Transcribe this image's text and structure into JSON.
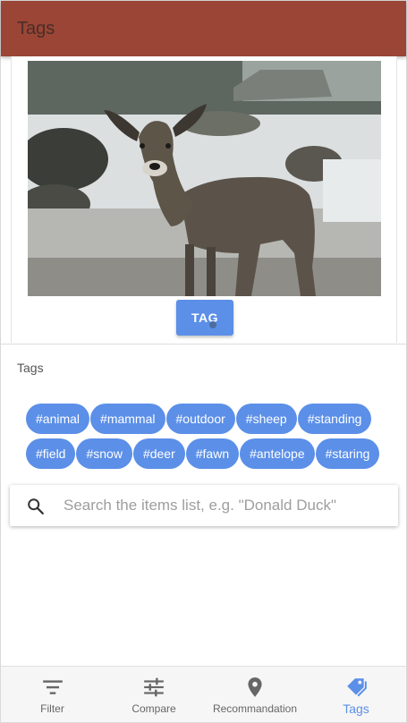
{
  "appbar": {
    "title": "Tags"
  },
  "photo": {
    "tag_button_label": "TAG"
  },
  "tags_section": {
    "heading": "Tags",
    "row1": [
      "#animal",
      "#mammal",
      "#outdoor",
      "#sheep",
      "#standing"
    ],
    "row2": [
      "#field",
      "#snow",
      "#deer",
      "#fawn",
      "#antelope",
      "#staring"
    ]
  },
  "search": {
    "placeholder": "Search the items list, e.g. \"Donald Duck\"",
    "value": ""
  },
  "bottom_nav": {
    "items": [
      {
        "label": "Filter",
        "icon": "filter-icon"
      },
      {
        "label": "Compare",
        "icon": "sliders-icon"
      },
      {
        "label": "Recommandation",
        "icon": "location-pin-icon"
      },
      {
        "label": "Tags",
        "icon": "tag-icon",
        "active": true
      }
    ]
  },
  "colors": {
    "appbar": "#9a4535",
    "accent": "#5b8fe8"
  }
}
